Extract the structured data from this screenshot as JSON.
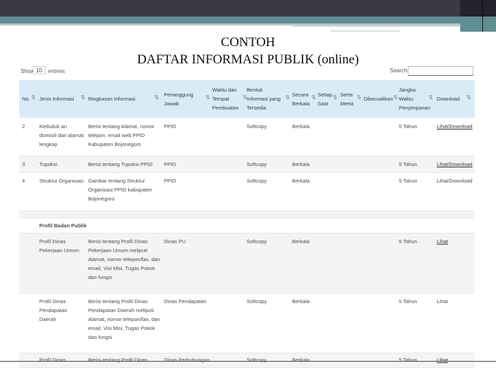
{
  "slide": {
    "title_line1": "CONTOH",
    "title_line2": "DAFTAR INFORMASI PUBLIK (online)"
  },
  "controls": {
    "show_label": "Show",
    "show_value": "10",
    "entries_label": "entries",
    "search_label": "Search:"
  },
  "table": {
    "headers": {
      "no": "No.",
      "jenis": "Jenis Informasi",
      "ringkasan": "Ringkasan Informasi",
      "penanggung": "Penanggung Jawab",
      "waktu": "Waktu dan Tempat Pembuatan",
      "bentuk": "Bentuk Informasi yang Tersedia",
      "secara": "Secara Berkala",
      "setiap": "Setiap Saat",
      "serta": "Serta Merta",
      "dikecualikan": "Dikecualikan",
      "jangka": "Jangka Waktu Penyimpanan",
      "download": "Download"
    },
    "rows": [
      {
        "no": "2",
        "jenis": "Keduduk an domisili dan alamat lengkap",
        "ringkasan": "Berisi tentang Alamat, nomor telepon, email web PPID Kabupaten Bojonegoro",
        "pj": "PPID",
        "bentuk": "Softcopy",
        "berkala": "Berkala",
        "jangka": "5 Tahun",
        "download": "Lihat/Download"
      },
      {
        "no": "3",
        "jenis": "Tupoksi",
        "ringkasan": "Berisi tentang Tupoksi PPID",
        "pj": "PPID",
        "bentuk": "Softcopy",
        "berkala": "Berkala",
        "jangka": "5 Tahun",
        "download": "Lihat/Download"
      },
      {
        "no": "4",
        "jenis": "Struktur Organisasi",
        "ringkasan": "Gambar tentang Struktur Organisasi PPID kabupaten Bojonegoro",
        "pj": "PPID",
        "bentuk": "Softcopy",
        "berkala": "Berkala",
        "jangka": "5 Tahun",
        "download": "Lihat/Download"
      },
      {
        "group": "Profil Badan Publik"
      },
      {
        "no": "",
        "jenis": "Profil Dinas Pekerjaan Umum",
        "ringkasan": "Berisi tentang Profil Dinas Pekerjaan Umum meliputi Alamat, nomor telepon/fax, dan email, Visi Misi, Tugas Pokok dan fungsi",
        "pj": "Dinas PU",
        "bentuk": "Softcopy",
        "berkala": "Berkala",
        "jangka": "5 Tahun",
        "download": "Lihat"
      },
      {
        "no": "",
        "jenis": "Profil Dinas Pendapatan Daerah",
        "ringkasan": "Berisi tentang Profil Dinas Pendapatan Daerah meliputi Alamat, nomor telepon/fax, dan email, Visi Misi, Tugas Pokok dan fungsi",
        "pj": "Dinas Pendapatan",
        "bentuk": "Softcopy",
        "berkala": "Berkala",
        "jangka": "5 Tahun",
        "download": "Lihat"
      },
      {
        "no": "",
        "jenis": "Profil Dinas",
        "ringkasan": "Berisi tentang Profil Dinas",
        "pj": "Dinas Perhubungan",
        "bentuk": "Softcopy",
        "berkala": "Berkala",
        "jangka": "5 Tahun",
        "download": "Lihat"
      }
    ]
  }
}
